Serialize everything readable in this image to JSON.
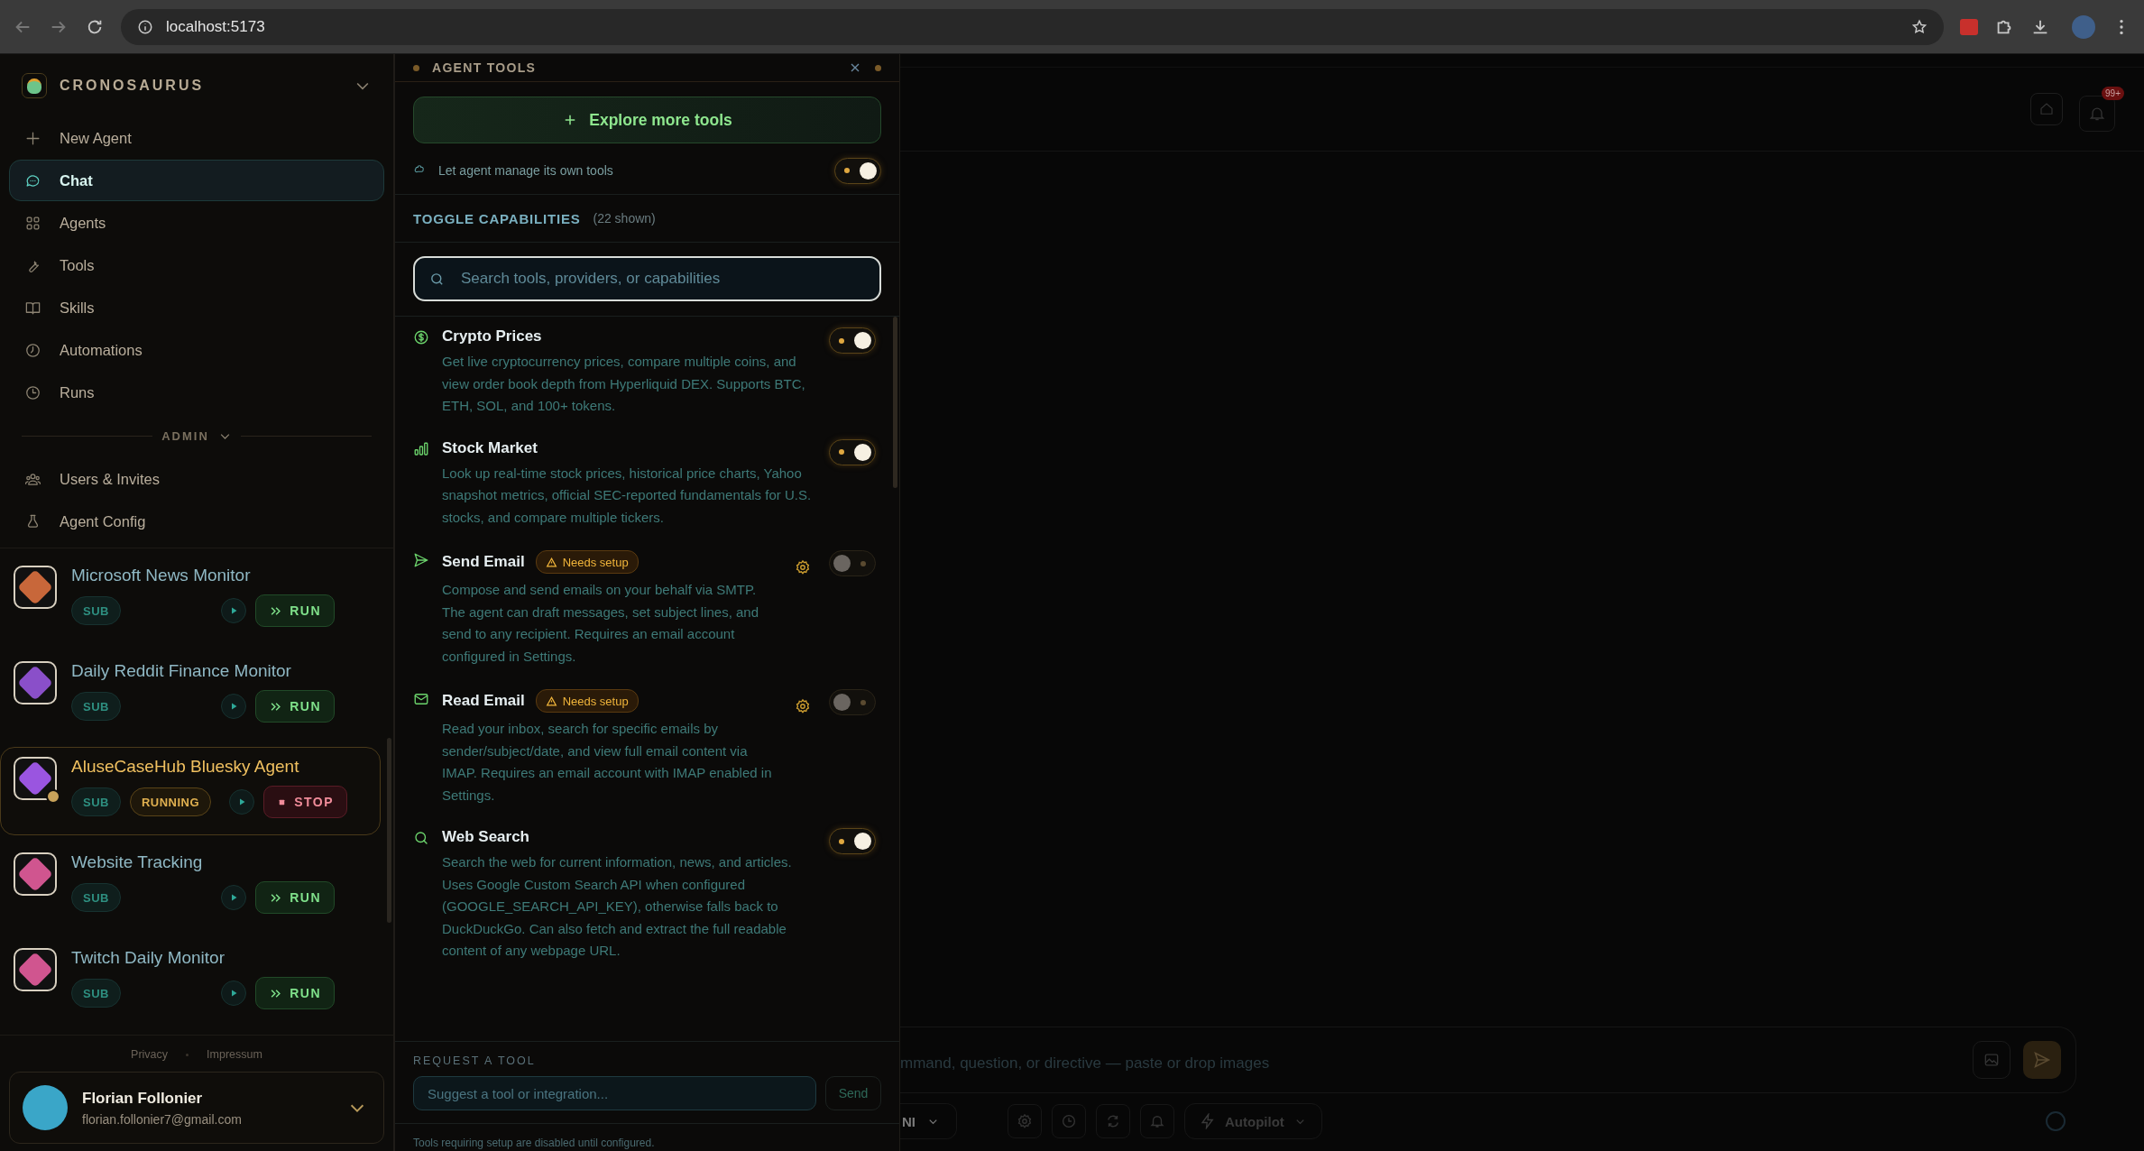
{
  "browser": {
    "url": "localhost:5173"
  },
  "sidebar": {
    "brand": "CRONOSAURUS",
    "nav": [
      {
        "label": "New Agent",
        "kind": "plus",
        "selected": false
      },
      {
        "label": "Chat",
        "kind": "chat",
        "selected": true
      },
      {
        "label": "Agents",
        "kind": "grid",
        "selected": false
      },
      {
        "label": "Tools",
        "kind": "wrench",
        "selected": false
      },
      {
        "label": "Skills",
        "kind": "book",
        "selected": false
      },
      {
        "label": "Automations",
        "kind": "clock",
        "selected": false
      },
      {
        "label": "Runs",
        "kind": "history",
        "selected": false
      }
    ],
    "admin_label": "ADMIN",
    "admin_nav": [
      {
        "label": "Users & Invites",
        "kind": "users",
        "selected": false
      },
      {
        "label": "Agent Config",
        "kind": "flask",
        "selected": false
      }
    ],
    "agents": [
      {
        "name": "Microsoft News Monitor",
        "badge": "SUB",
        "running": false,
        "action": "RUN",
        "color": "#c8673a"
      },
      {
        "name": "Daily Reddit Finance Monitor",
        "badge": "SUB",
        "running": false,
        "action": "RUN",
        "color": "#8a4fc9"
      },
      {
        "name": "AluseCaseHub Bluesky Agent",
        "badge": "SUB",
        "status": "RUNNING",
        "running": true,
        "action": "STOP",
        "color": "#9a55e0"
      },
      {
        "name": "Website Tracking",
        "badge": "SUB",
        "running": false,
        "action": "RUN",
        "color": "#d0558f"
      },
      {
        "name": "Twitch Daily Monitor",
        "badge": "SUB",
        "running": false,
        "action": "RUN",
        "color": "#d0558f"
      }
    ],
    "footer_links": [
      "Privacy",
      "Impressum"
    ],
    "user": {
      "name": "Florian Follonier",
      "email": "florian.follonier7@gmail.com"
    }
  },
  "tools_panel": {
    "title": "AGENT TOOLS",
    "explore_button": "Explore more tools",
    "manage_tools": {
      "label": "Let agent manage its own tools",
      "on": true
    },
    "section_title": "TOGGLE CAPABILITIES",
    "count": "(22 shown)",
    "search_placeholder": "Search tools, providers, or capabilities",
    "tools": [
      {
        "kind": "crypto",
        "name": "Crypto Prices",
        "description": "Get live cryptocurrency prices, compare multiple coins, and view order book depth from Hyperliquid DEX. Supports BTC, ETH, SOL, and 100+ tokens.",
        "on": true
      },
      {
        "kind": "stock",
        "name": "Stock Market",
        "description": "Look up real-time stock prices, historical price charts, Yahoo snapshot metrics, official SEC-reported fundamentals for U.S. stocks, and compare multiple tickers.",
        "on": true
      },
      {
        "kind": "send",
        "name": "Send Email",
        "badge": "Needs setup",
        "description": "Compose and send emails on your behalf via SMTP. The agent can draft messages, set subject lines, and send to any recipient. Requires an email account configured in Settings.",
        "on": false
      },
      {
        "kind": "mail",
        "name": "Read Email",
        "badge": "Needs setup",
        "description": "Read your inbox, search for specific emails by sender/subject/date, and view full email content via IMAP. Requires an email account with IMAP enabled in Settings.",
        "on": false
      },
      {
        "kind": "search",
        "name": "Web Search",
        "description": "Search the web for current information, news, and articles. Uses Google Custom Search API when configured (GOOGLE_SEARCH_API_KEY), otherwise falls back to DuckDuckGo. Can also fetch and extract the full readable content of any webpage URL.",
        "on": true
      }
    ],
    "request_label": "REQUEST A TOOL",
    "request_placeholder": "Suggest a tool or integration...",
    "send_button": "Send",
    "note": "Tools requiring setup are disabled until configured."
  },
  "main": {
    "notification_badge": "99+",
    "chat_placeholder": "mmand, question, or directive — paste or drop images",
    "model_label": "NI",
    "mode_label": "Autopilot"
  }
}
